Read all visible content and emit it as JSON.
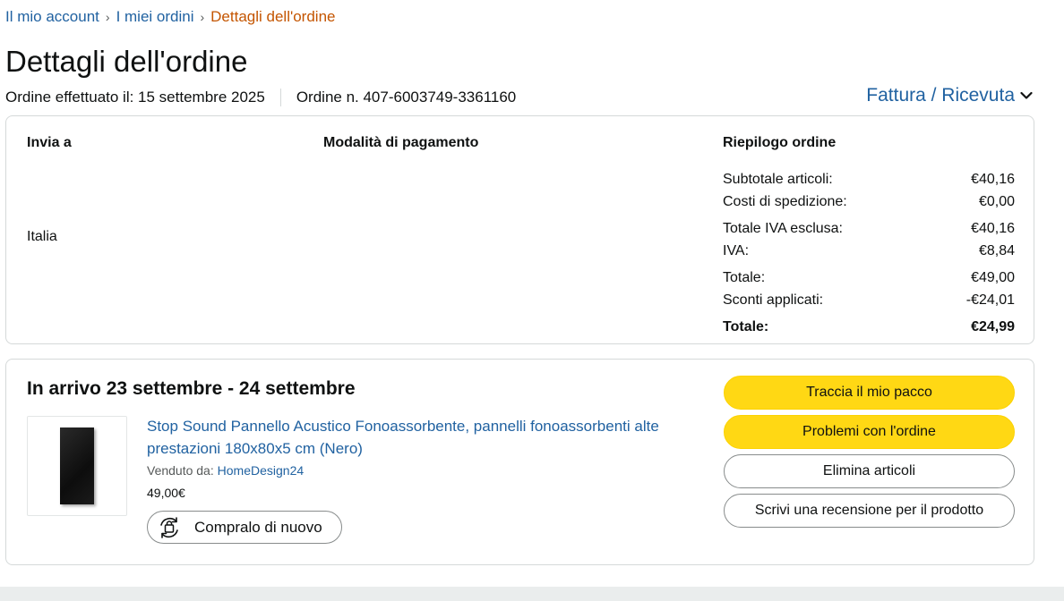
{
  "breadcrumb": {
    "account": "Il mio account",
    "separator": "›",
    "orders": "I miei ordini",
    "current": "Dettagli dell'ordine"
  },
  "page_title": "Dettagli dell'ordine",
  "order_meta": {
    "placed": "Ordine effettuato il: 15 settembre 2025",
    "number": "Ordine n. 407-6003749-3361160"
  },
  "invoice_link": "Fattura / Ricevuta",
  "summary_card": {
    "ship_to_heading": "Invia a",
    "ship_country": "Italia",
    "payment_heading": "Modalità di pagamento",
    "summary_heading": "Riepilogo ordine",
    "rows": [
      {
        "label": "Subtotale articoli:",
        "value": "€40,16"
      },
      {
        "label": "Costi di spedizione:",
        "value": "€0,00"
      },
      {
        "label": "Totale IVA esclusa:",
        "value": "€40,16"
      },
      {
        "label": "IVA:",
        "value": "€8,84"
      },
      {
        "label": "Totale:",
        "value": "€49,00"
      },
      {
        "label": "Sconti applicati:",
        "value": "-€24,01"
      },
      {
        "label": "Totale:",
        "value": "€24,99"
      }
    ]
  },
  "shipment": {
    "arrival": "In arrivo 23 settembre - 24 settembre",
    "product_title": "Stop Sound Pannello Acustico Fonoassorbente, pannelli fonoassorbenti alte prestazioni 180x80x5 cm (Nero)",
    "sold_by_label": "Venduto da:",
    "seller": "HomeDesign24",
    "price": "49,00€",
    "buy_again": "Compralo di nuovo",
    "actions": {
      "track": "Traccia il mio pacco",
      "problems": "Problemi con l'ordine",
      "delete": "Elimina articoli",
      "review": "Scrivi una recensione per il prodotto"
    }
  },
  "colors": {
    "link": "#2162a1",
    "breadcrumb_current": "#c45500",
    "primary_button": "#ffd814",
    "border": "#d5d9d9"
  },
  "icons": [
    "chevron-down-icon",
    "buy-again-icon",
    "product-image"
  ]
}
